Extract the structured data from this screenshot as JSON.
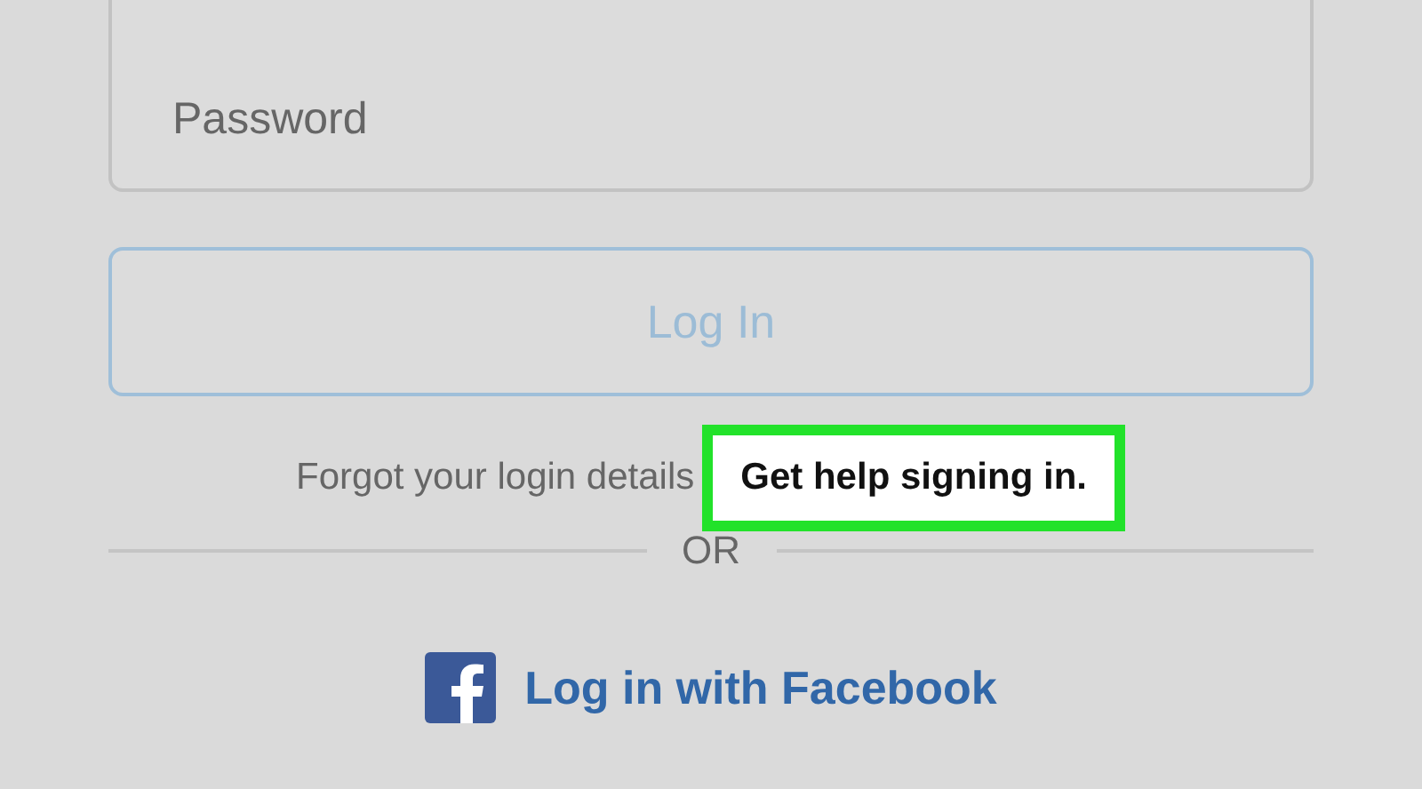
{
  "password_field": {
    "placeholder": "Password"
  },
  "login_button": {
    "label": "Log In",
    "disabled": true
  },
  "help": {
    "text": "Forgot your login details",
    "link": "Get help signing in.",
    "highlighted": true
  },
  "divider": {
    "label": "OR"
  },
  "facebook_login": {
    "label": "Log in with Facebook"
  }
}
